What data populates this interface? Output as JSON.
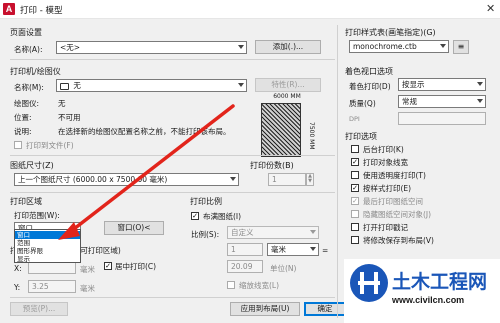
{
  "window": {
    "title": "打印 - 模型",
    "close": "✕"
  },
  "page_setup": {
    "group": "页面设置",
    "name_label": "名称(A):",
    "name_value": "<无>",
    "add_button": "添加(.)..."
  },
  "printer": {
    "group": "打印机/绘图仪",
    "name_label": "名称(M):",
    "name_value": "无",
    "properties_button": "特性(R)...",
    "plotter_label": "绘图仪:",
    "plotter_value": "无",
    "location_label": "位置:",
    "location_value": "不可用",
    "desc_label": "说明:",
    "desc_value": "在选择新的绘图仪配置名称之前，不能打印该布局。",
    "print_to_file": "打印到文件(F)",
    "preview_width": "6000 MM",
    "preview_height": "7500 MM"
  },
  "paper_size": {
    "group": "图纸尺寸(Z)",
    "value": "上一个图纸尺寸 (6000.00 x 7500.00 毫米)"
  },
  "copies": {
    "group": "打印份数(B)",
    "value": "1"
  },
  "print_area": {
    "group": "打印区域",
    "range_label": "打印范围(W):",
    "range_value": "窗口",
    "window_button": "窗口(O)<",
    "options": [
      "窗口",
      "范围",
      "图形界限",
      "显示"
    ],
    "selected_index": 0
  },
  "offset": {
    "group": "打印偏移(原点设置在可打印区域)",
    "center": "居中打印(C)",
    "x_label": "X:",
    "x_value": "",
    "y_label": "Y:",
    "y_value": "3.25",
    "unit": "毫米"
  },
  "scale": {
    "group": "打印比例",
    "fit": "布满图纸(I)",
    "ratio_label": "比例(S):",
    "ratio_value": "自定义",
    "val1": "1",
    "unit1": "毫米",
    "equals": "=",
    "val2": "20.09",
    "unit2": "单位(N)",
    "lineweight": "缩放线宽(L)"
  },
  "style_table": {
    "group": "打印样式表(画笔指定)(G)",
    "value": "monochrome.ctb"
  },
  "shaded_viewport": {
    "group": "着色视口选项",
    "shade_label": "着色打印(D)",
    "shade_value": "按显示",
    "quality_label": "质量(Q)",
    "quality_value": "常规",
    "dpi_label": "DPI",
    "dpi_value": ""
  },
  "options": {
    "group": "打印选项",
    "items": [
      {
        "label": "后台打印(K)",
        "checked": false,
        "enabled": true
      },
      {
        "label": "打印对象线宽",
        "checked": true,
        "enabled": true
      },
      {
        "label": "使用透明度打印(T)",
        "checked": false,
        "enabled": true
      },
      {
        "label": "按样式打印(E)",
        "checked": true,
        "enabled": true
      },
      {
        "label": "最后打印图纸空间",
        "checked": true,
        "enabled": false
      },
      {
        "label": "隐藏图纸空间对象(J)",
        "checked": false,
        "enabled": false
      },
      {
        "label": "打开打印戳记",
        "checked": false,
        "enabled": true
      },
      {
        "label": "将修改保存到布局(V)",
        "checked": false,
        "enabled": true
      }
    ]
  },
  "footer": {
    "preview": "预览(P)...",
    "apply_layout": "应用到布局(U)",
    "ok": "确定"
  },
  "watermark": {
    "brand": "土木工程网",
    "url": "www.civilcn.com"
  }
}
